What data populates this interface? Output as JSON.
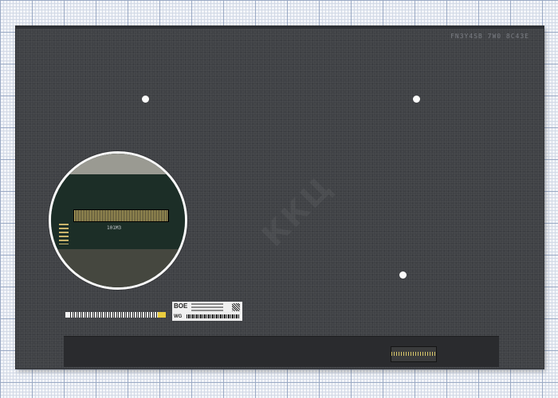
{
  "panel": {
    "code": "FN3Y4SB 7W0 8C43E",
    "zoom_text": "101M3"
  },
  "label": {
    "logo": "BOE",
    "prefix": "WG"
  },
  "watermark": {
    "text": "ККЦ"
  },
  "colors": {
    "panel": "#404246",
    "bezel": "#2a2b2e",
    "background_grid": "#9aa9c4",
    "barcode_accent": "#e9cc3e"
  }
}
